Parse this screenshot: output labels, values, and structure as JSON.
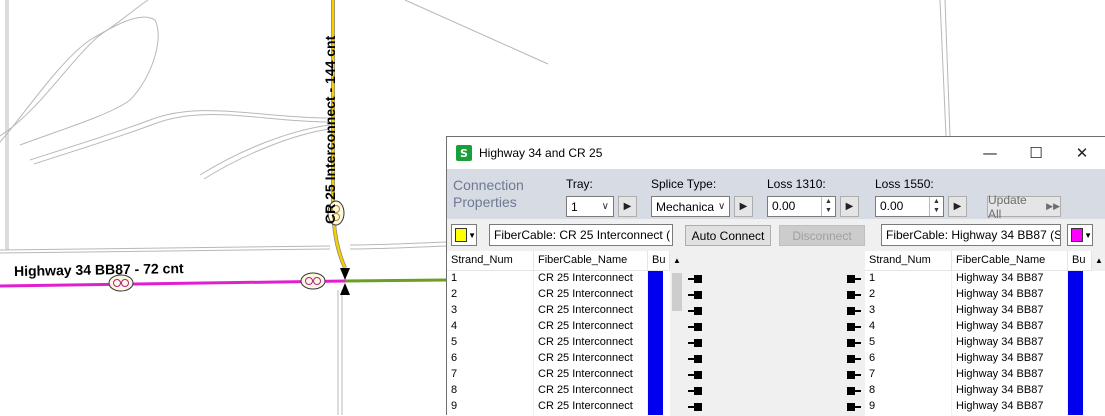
{
  "map": {
    "label_highway": "Highway 34 BB87 - 72 cnt",
    "label_cr25": "CR 25 Interconnect - 144 cnt",
    "colors": {
      "highway_line": "#e020d0",
      "cr25_line": "#f4d000",
      "green_line": "#6aa020"
    }
  },
  "dialog": {
    "title": "Highway 34 and CR 25",
    "icon": "splice-app-icon",
    "connection_properties": "Connection Properties",
    "tray_label": "Tray:",
    "tray_value": "1",
    "splice_type_label": "Splice Type:",
    "splice_type_value": "Mechanica",
    "loss1310_label": "Loss 1310:",
    "loss1310_value": "0.00",
    "loss1550_label": "Loss 1550:",
    "loss1550_value": "0.00",
    "update_all": "Update All",
    "left_cable_select": "FiberCable: CR 25 Interconnect (",
    "right_cable_select": "FiberCable: Highway 34 BB87 (S",
    "auto_connect": "Auto Connect",
    "disconnect": "Disconnect",
    "left_color": "#ffff00",
    "right_color": "#ff00ff"
  },
  "left_grid": {
    "headers": [
      "Strand_Num",
      "FiberCable_Name",
      "Bu"
    ],
    "rows": [
      {
        "strand": "1",
        "name": "CR 25 Interconnect"
      },
      {
        "strand": "2",
        "name": "CR 25 Interconnect"
      },
      {
        "strand": "3",
        "name": "CR 25 Interconnect"
      },
      {
        "strand": "4",
        "name": "CR 25 Interconnect"
      },
      {
        "strand": "5",
        "name": "CR 25 Interconnect"
      },
      {
        "strand": "6",
        "name": "CR 25 Interconnect"
      },
      {
        "strand": "7",
        "name": "CR 25 Interconnect"
      },
      {
        "strand": "8",
        "name": "CR 25 Interconnect"
      },
      {
        "strand": "9",
        "name": "CR 25 Interconnect"
      }
    ]
  },
  "right_grid": {
    "headers": [
      "Strand_Num",
      "FiberCable_Name",
      "Bu"
    ],
    "rows": [
      {
        "strand": "1",
        "name": "Highway 34 BB87"
      },
      {
        "strand": "2",
        "name": "Highway 34 BB87"
      },
      {
        "strand": "3",
        "name": "Highway 34 BB87"
      },
      {
        "strand": "4",
        "name": "Highway 34 BB87"
      },
      {
        "strand": "5",
        "name": "Highway 34 BB87"
      },
      {
        "strand": "6",
        "name": "Highway 34 BB87"
      },
      {
        "strand": "7",
        "name": "Highway 34 BB87"
      },
      {
        "strand": "8",
        "name": "Highway 34 BB87"
      },
      {
        "strand": "9",
        "name": "Highway 34 BB87"
      }
    ]
  }
}
